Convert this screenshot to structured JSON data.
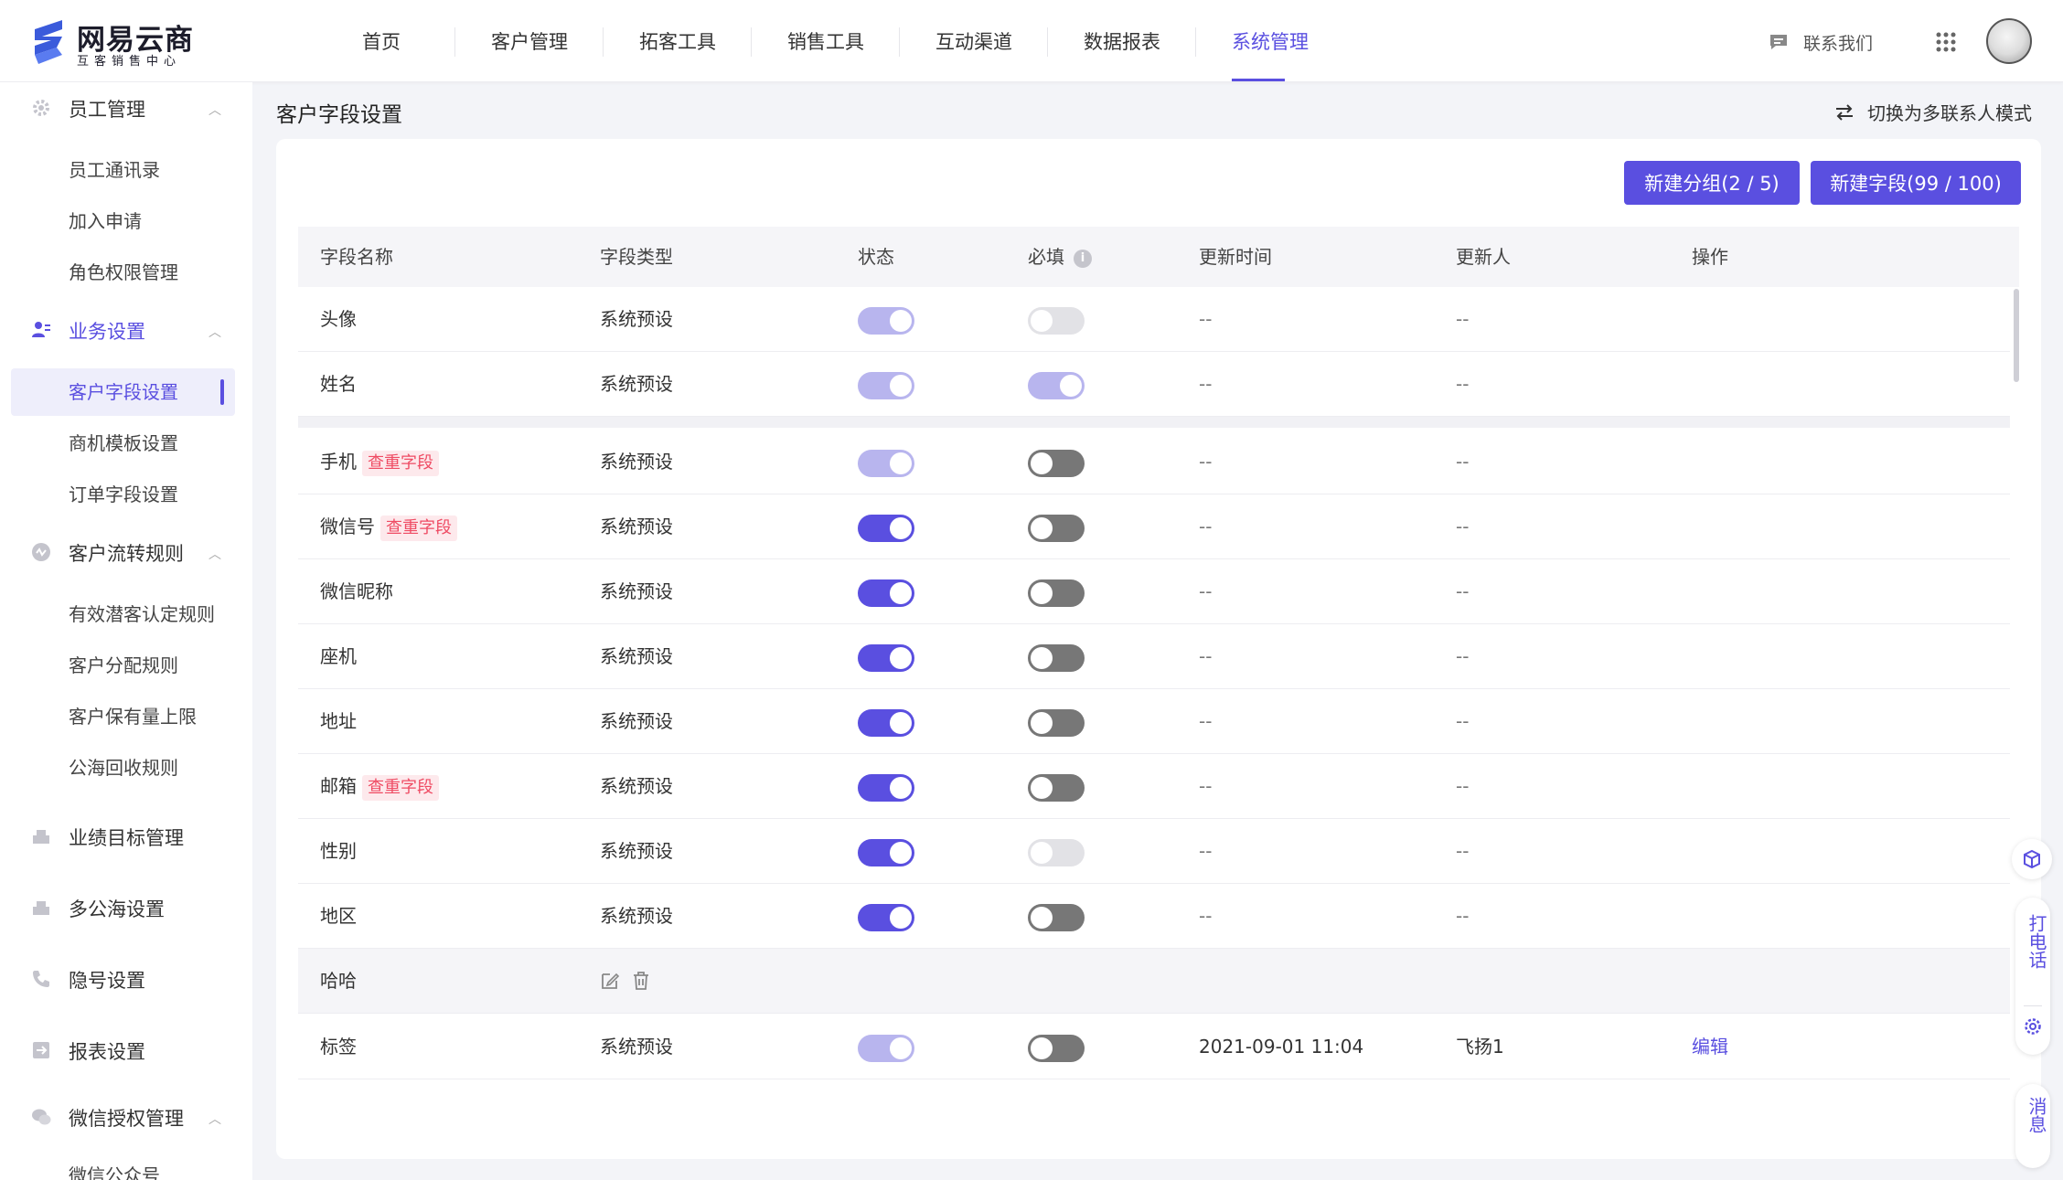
{
  "brand": {
    "name": "网易云商",
    "subtitle": "互客销售中心",
    "accent_color": "#5a4fe0"
  },
  "nav": {
    "items": [
      {
        "label": "首页"
      },
      {
        "label": "客户管理"
      },
      {
        "label": "拓客工具"
      },
      {
        "label": "销售工具"
      },
      {
        "label": "互动渠道"
      },
      {
        "label": "数据报表"
      },
      {
        "label": "系统管理",
        "active": true
      }
    ],
    "contact_label": "联系我们"
  },
  "sidebar": {
    "groups": [
      {
        "label": "员工管理",
        "icon": "gear-icon",
        "expanded": true,
        "items": [
          {
            "label": "员工通讯录"
          },
          {
            "label": "加入申请"
          },
          {
            "label": "角色权限管理"
          }
        ]
      },
      {
        "label": "业务设置",
        "icon": "user-settings-icon",
        "expanded": true,
        "active": true,
        "items": [
          {
            "label": "客户字段设置",
            "active": true
          },
          {
            "label": "商机模板设置"
          },
          {
            "label": "订单字段设置"
          }
        ]
      },
      {
        "label": "客户流转规则",
        "icon": "flow-icon",
        "expanded": true,
        "items": [
          {
            "label": "有效潜客认定规则"
          },
          {
            "label": "客户分配规则"
          },
          {
            "label": "客户保有量上限"
          },
          {
            "label": "公海回收规则"
          }
        ]
      },
      {
        "label": "业绩目标管理",
        "icon": "target-icon"
      },
      {
        "label": "多公海设置",
        "icon": "sea-icon"
      },
      {
        "label": "隐号设置",
        "icon": "phone-icon"
      },
      {
        "label": "报表设置",
        "icon": "report-icon"
      },
      {
        "label": "微信授权管理",
        "icon": "wechat-icon",
        "expanded": true,
        "items": [
          {
            "label": "微信公众号"
          }
        ]
      }
    ]
  },
  "page": {
    "title": "客户字段设置",
    "switch_mode_label": "切换为多联系人模式",
    "new_group_button": "新建分组(2 / 5)",
    "new_field_button": "新建字段(99 / 100)"
  },
  "table": {
    "columns": [
      "字段名称",
      "字段类型",
      "状态",
      "必填",
      "更新时间",
      "更新人",
      "操作"
    ],
    "rows": [
      {
        "name": "头像",
        "tag": "",
        "type": "系统预设",
        "status": "on-disabled",
        "required": "off-disabled",
        "updated_at": "--",
        "updated_by": "--",
        "action": ""
      },
      {
        "name": "姓名",
        "tag": "",
        "type": "系统预设",
        "status": "on-disabled",
        "required": "on-disabled",
        "updated_at": "--",
        "updated_by": "--",
        "action": ""
      },
      {
        "name": "手机",
        "tag": "查重字段",
        "type": "系统预设",
        "status": "on-disabled",
        "required": "off-enabled",
        "updated_at": "--",
        "updated_by": "--",
        "action": ""
      },
      {
        "name": "微信号",
        "tag": "查重字段",
        "type": "系统预设",
        "status": "on-enabled",
        "required": "off-enabled",
        "updated_at": "--",
        "updated_by": "--",
        "action": ""
      },
      {
        "name": "微信昵称",
        "tag": "",
        "type": "系统预设",
        "status": "on-enabled",
        "required": "off-enabled",
        "updated_at": "--",
        "updated_by": "--",
        "action": ""
      },
      {
        "name": "座机",
        "tag": "",
        "type": "系统预设",
        "status": "on-enabled",
        "required": "off-enabled",
        "updated_at": "--",
        "updated_by": "--",
        "action": ""
      },
      {
        "name": "地址",
        "tag": "",
        "type": "系统预设",
        "status": "on-enabled",
        "required": "off-enabled",
        "updated_at": "--",
        "updated_by": "--",
        "action": ""
      },
      {
        "name": "邮箱",
        "tag": "查重字段",
        "type": "系统预设",
        "status": "on-enabled",
        "required": "off-enabled",
        "updated_at": "--",
        "updated_by": "--",
        "action": ""
      },
      {
        "name": "性别",
        "tag": "",
        "type": "系统预设",
        "status": "on-enabled",
        "required": "off-disabled",
        "updated_at": "--",
        "updated_by": "--",
        "action": ""
      },
      {
        "name": "地区",
        "tag": "",
        "type": "系统预设",
        "status": "on-enabled",
        "required": "off-enabled",
        "updated_at": "--",
        "updated_by": "--",
        "action": ""
      }
    ],
    "group_row": {
      "name": "哈哈"
    },
    "tail_rows": [
      {
        "name": "标签",
        "tag": "",
        "type": "系统预设",
        "status": "on-disabled",
        "required": "off-enabled",
        "updated_at": "2021-09-01 11:04",
        "updated_by": "飞扬1",
        "action": "编辑"
      }
    ]
  },
  "float_panel": {
    "call_label": "打电话",
    "message_label": "消息"
  }
}
